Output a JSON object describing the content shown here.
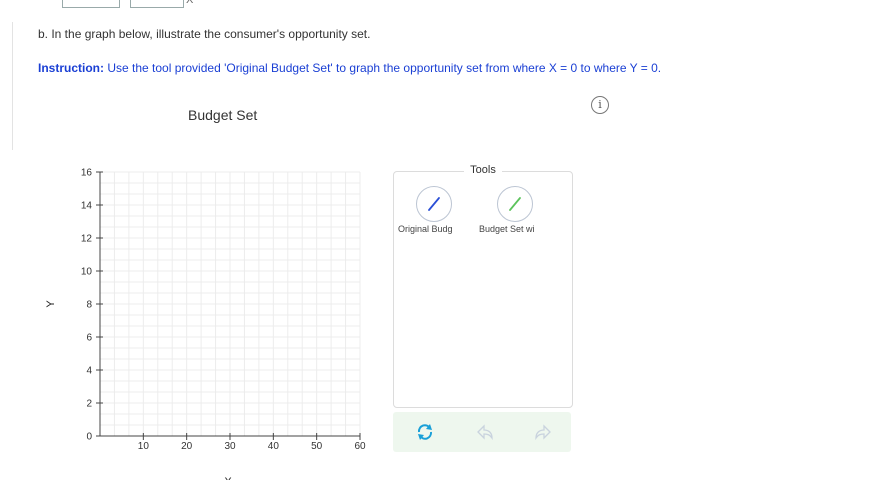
{
  "top_fragment": {
    "x_label": "X"
  },
  "question": {
    "text": "b. In the graph below, illustrate the consumer's opportunity set."
  },
  "instruction": {
    "label": "Instruction:",
    "text": " Use the tool provided 'Original Budget Set' to graph the opportunity set from where X = 0 to where Y = 0."
  },
  "info": {
    "glyph": "i"
  },
  "chart_data": {
    "type": "line",
    "title": "Budget Set",
    "xlabel": "X",
    "ylabel": "Y",
    "xlim": [
      0,
      60
    ],
    "ylim": [
      0,
      16
    ],
    "x_ticks": [
      10,
      20,
      30,
      40,
      50,
      60
    ],
    "y_ticks": [
      0,
      2,
      4,
      6,
      8,
      10,
      12,
      14,
      16
    ],
    "grid": true,
    "series": []
  },
  "tools": {
    "title": "Tools",
    "items": [
      {
        "label": "Original Budg",
        "icon": "line-tool-icon",
        "color": "#2a4fd6"
      },
      {
        "label": "Budget Set wi",
        "icon": "line-tool-icon",
        "color": "#5cc35c"
      }
    ]
  },
  "actions": {
    "reset_icon": "reset-icon",
    "undo_icon": "undo-icon",
    "redo_icon": "redo-icon",
    "accent": "#1aa0d8"
  }
}
